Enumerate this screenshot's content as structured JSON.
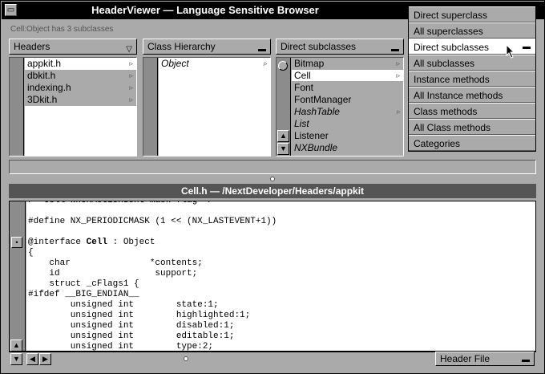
{
  "window": {
    "title": "HeaderViewer — Language Sensitive Browser",
    "status": "Cell:Object has 3 subclasses",
    "close_glyph": "×",
    "miniaturize_glyph": "▭"
  },
  "browser": {
    "col1": {
      "popup": "Headers",
      "items": [
        {
          "label": "appkit.h",
          "arrow": "▹"
        },
        {
          "label": "dbkit.h",
          "arrow": "▹"
        },
        {
          "label": "indexing.h",
          "arrow": "▹"
        },
        {
          "label": "3Dkit.h",
          "arrow": "▹"
        }
      ]
    },
    "col2": {
      "popup": "Class Hierarchy",
      "items": [
        {
          "label": "Object",
          "arrow": "▹"
        }
      ]
    },
    "col3": {
      "popup": "Direct subclasses",
      "items": [
        {
          "label": "Bitmap",
          "arrow": "▹"
        },
        {
          "label": "Cell",
          "arrow": "▹"
        },
        {
          "label": "Font",
          "arrow": ""
        },
        {
          "label": "FontManager",
          "arrow": ""
        },
        {
          "label": "HashTable",
          "arrow": "▹"
        },
        {
          "label": "List",
          "arrow": ""
        },
        {
          "label": "Listener",
          "arrow": ""
        },
        {
          "label": "NXBundle",
          "arrow": ""
        }
      ]
    }
  },
  "menu": {
    "items": [
      "Direct superclass",
      "All superclasses",
      "Direct subclasses",
      "All subclasses",
      "Instance methods",
      "All Instance methods",
      "Class methods",
      "All Class methods",
      "Categories"
    ]
  },
  "file": {
    "path": "Cell.h — /NextDeveloper/Headers/appkit"
  },
  "code": {
    "lines": [
      "/* Cell whenActionSent mask flag */",
      "",
      "#define NX_PERIODICMASK (1 << (NX_LASTEVENT+1))",
      "",
      "@interface Cell : Object",
      "{",
      "    char               *contents;",
      "    id                  support;",
      "    struct _cFlags1 {",
      "#ifdef __BIG_ENDIAN__",
      "        unsigned int        state:1;",
      "        unsigned int        highlighted:1;",
      "        unsigned int        disabled:1;",
      "        unsigned int        editable:1;",
      "        unsigned int        type:2;"
    ]
  },
  "bottom": {
    "popup": "Header File"
  }
}
